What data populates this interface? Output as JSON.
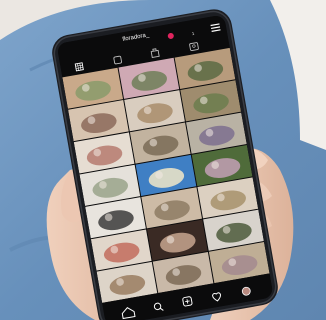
{
  "profile": {
    "username": "floradora_",
    "notification_count": "1"
  },
  "colors": {
    "jeans": "#6f96c0",
    "phone_body": "#1b1d22",
    "screen": "#0b0b0c",
    "notification_badge": "#e0245e",
    "skin": "#e9c3ac"
  },
  "grid": {
    "columns": 3,
    "rows": 7,
    "tiles": [
      {
        "subject": "flower-arrangement",
        "colors": [
          "#c9a98a",
          "#8a9b6a"
        ]
      },
      {
        "subject": "florist-with-bouquet",
        "colors": [
          "#cfa9b4",
          "#6f7f58"
        ]
      },
      {
        "subject": "flower-arrangement",
        "colors": [
          "#b79b7c",
          "#5c6b44"
        ]
      },
      {
        "subject": "flower-arrangement",
        "colors": [
          "#d7c4b0",
          "#8c6a5a"
        ]
      },
      {
        "subject": "flower-arrangement",
        "colors": [
          "#d9cdbf",
          "#a88c6a"
        ]
      },
      {
        "subject": "flower-arrangement",
        "colors": [
          "#9f8c6e",
          "#6b7c4e"
        ]
      },
      {
        "subject": "flower-arrangement",
        "colors": [
          "#e6ddd2",
          "#b57a6e"
        ]
      },
      {
        "subject": "table-setting",
        "colors": [
          "#c2b39f",
          "#7a6b56"
        ]
      },
      {
        "subject": "flower-arrangement",
        "colors": [
          "#b9b2a4",
          "#7d6f8f"
        ]
      },
      {
        "subject": "wedding-table",
        "colors": [
          "#e5e1da",
          "#9aa38a"
        ]
      },
      {
        "subject": "blue-sky-branches",
        "colors": [
          "#3f7fc4",
          "#f2e7c8"
        ]
      },
      {
        "subject": "green-foliage",
        "colors": [
          "#4f6b3a",
          "#c3a0b6"
        ]
      },
      {
        "subject": "florist-portrait",
        "colors": [
          "#e8e4de",
          "#3b3b3b"
        ]
      },
      {
        "subject": "flower-arrangement",
        "colors": [
          "#cdbba6",
          "#8d7b63"
        ]
      },
      {
        "subject": "flower-arrangement",
        "colors": [
          "#dcd0c1",
          "#a7926b"
        ]
      },
      {
        "subject": "flower-arrangement",
        "colors": [
          "#e1d6ca",
          "#c26c5d"
        ]
      },
      {
        "subject": "chocolates-box",
        "colors": [
          "#3a2a24",
          "#c8a68f"
        ]
      },
      {
        "subject": "florist-portrait",
        "colors": [
          "#d8d3cc",
          "#4d5a3b"
        ]
      },
      {
        "subject": "flower-arrangement",
        "colors": [
          "#ddd4c8",
          "#9a7c60"
        ]
      },
      {
        "subject": "flower-arrangement",
        "colors": [
          "#c9b9a8",
          "#7c6a56"
        ]
      },
      {
        "subject": "flower-arrangement",
        "colors": [
          "#bfae95",
          "#a3898f"
        ]
      }
    ]
  },
  "top_icons": [
    "grid-icon",
    "reels-icon",
    "guides-icon",
    "tagged-icon"
  ],
  "bottom_nav": [
    "home-icon",
    "search-icon",
    "add-post-icon",
    "heart-icon",
    "profile-icon"
  ]
}
